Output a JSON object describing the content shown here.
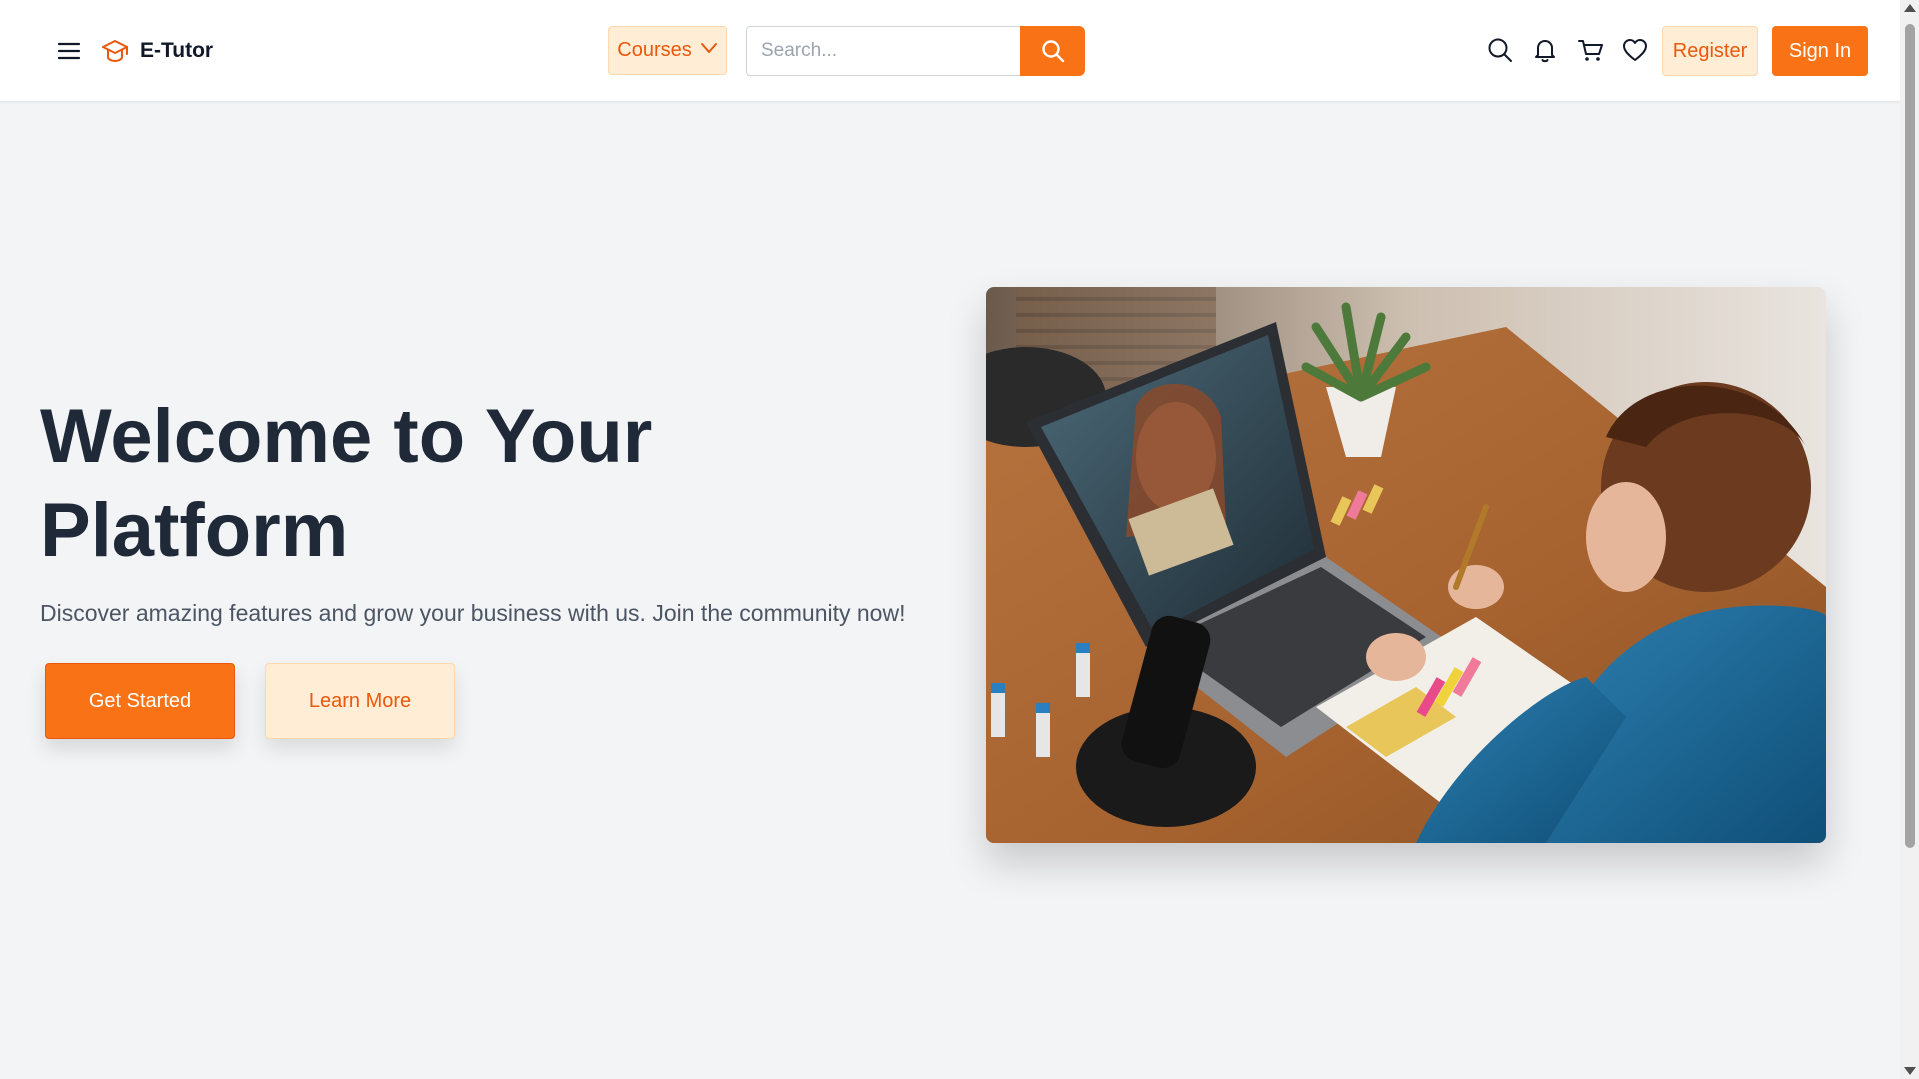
{
  "header": {
    "brand": "E-Tutor",
    "courses_label": "Courses",
    "search_placeholder": "Search...",
    "register_label": "Register",
    "signin_label": "Sign In",
    "icons": [
      "menu-icon",
      "graduation-cap-icon",
      "chevron-down-icon",
      "search-icon",
      "bell-icon",
      "cart-icon",
      "heart-icon"
    ]
  },
  "hero": {
    "title": "Welcome to Your Platform",
    "subtitle": "Discover amazing features and grow your business with us. Join the community now!",
    "primary_cta": "Get Started",
    "secondary_cta": "Learn More"
  },
  "colors": {
    "accent": "#f97316",
    "accent_light": "#ffedd5",
    "title": "#1f2937",
    "background": "#f3f4f6"
  }
}
